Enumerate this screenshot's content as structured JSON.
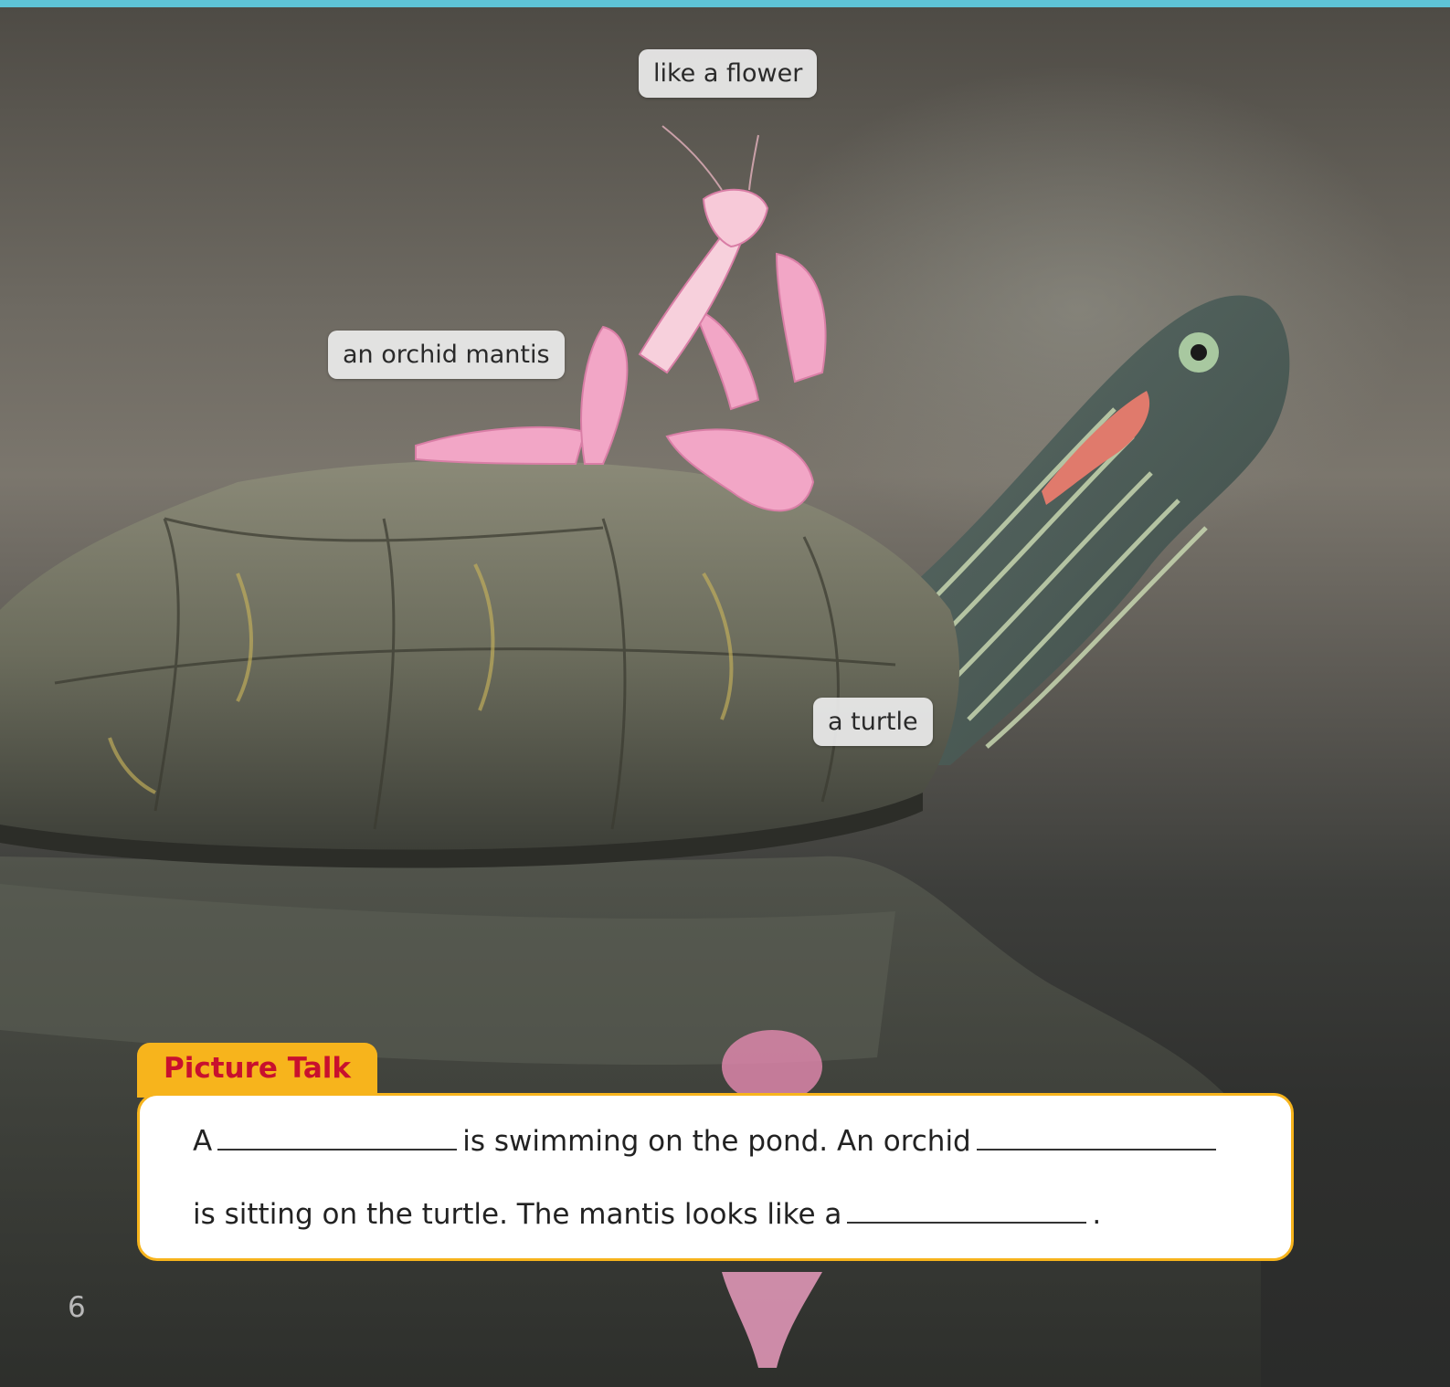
{
  "labels": {
    "flower": "like a flower",
    "mantis": "an orchid mantis",
    "turtle": "a turtle"
  },
  "picture_talk": {
    "title": "Picture Talk",
    "line1": {
      "before": "A",
      "middle": "is swimming on the pond. An orchid"
    },
    "line2": {
      "before": "is sitting on the turtle. The mantis looks like a",
      "after": "."
    }
  },
  "page_number": "6",
  "colors": {
    "top_bar": "#5ec3d6",
    "tab": "#f7b41c",
    "title": "#c8102e"
  }
}
